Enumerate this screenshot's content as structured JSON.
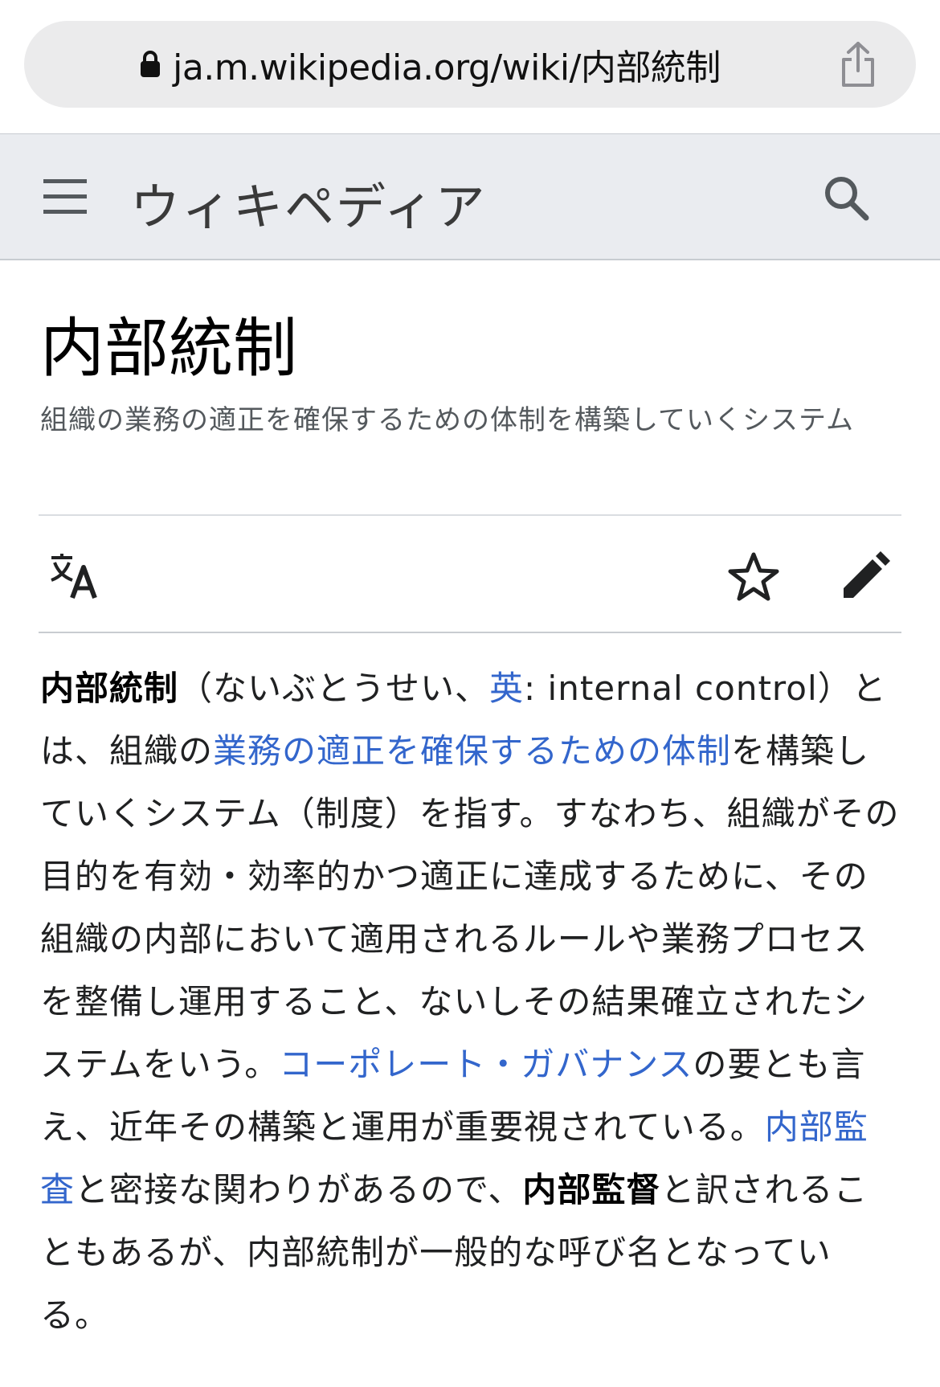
{
  "browser": {
    "url": "ja.m.wikipedia.org/wiki/内部統制"
  },
  "header": {
    "wordmark": "ウィキペディア"
  },
  "page": {
    "title": "内部統制",
    "description": "組織の業務の適正を確保するための体制を構築していくシステム"
  },
  "article": {
    "s1_bold": "内部統制",
    "s1_reading": "（ないぶとうせい、",
    "s1_lang_link": "英",
    "s1_english": ": internal control）とは、組織の",
    "s1_link": "業務の適正を確保するための体制",
    "s1_rest": "を構築していくシステム（制度）を指す。すなわち、組織がその目的を有効・効率的かつ適正に達成するために、その組織の内部において適用されるルールや業務プロセスを整備し運用すること、ないしその結果確立されたシステムをいう。",
    "s2_link": "コーポレート・ガバナンス",
    "s2_rest": "の要とも言え、近年その構築と運用が重要視されている。",
    "s3_link": "内部監査",
    "s3_rest": "と密接な関わりがあるので、",
    "s3_bold": "内部監督",
    "s3_end": "と訳されることもあるが、内部統制が一般的な呼び名となっている。"
  },
  "colors": {
    "link": "#3366cc",
    "header_bg": "#eaecf0",
    "text": "#202122",
    "description": "#54595d"
  },
  "icons": {
    "lock": "lock-icon",
    "share": "share-icon",
    "menu": "hamburger-menu-icon",
    "search": "search-icon",
    "language": "translate-icon",
    "watch": "star-icon",
    "edit": "pencil-icon"
  }
}
